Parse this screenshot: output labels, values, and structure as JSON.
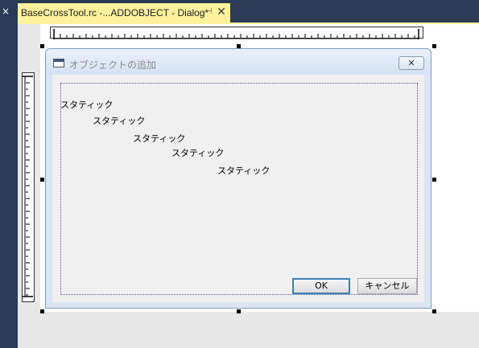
{
  "tab": {
    "title": "BaseCrossTool.rc -...ADDOBJECT - Dialog*",
    "pin_glyph": "⊣",
    "close_glyph": "✕"
  },
  "prev_tab_close_glyph": "×",
  "dialog": {
    "title": "オブジェクトの追加",
    "close_glyph": "✕",
    "statics": [
      {
        "text": "スタティック"
      },
      {
        "text": "スタティック"
      },
      {
        "text": "スタティック"
      },
      {
        "text": "スタティック"
      },
      {
        "text": "スタティック"
      }
    ],
    "ok_label": "OK",
    "cancel_label": "キャンセル"
  },
  "colors": {
    "tab_active": "#fff29d",
    "chrome": "#2b3a55",
    "dialog_frame": "#dbe6f4",
    "client": "#f0f0f0",
    "default_button_border": "#3c7fb1"
  }
}
